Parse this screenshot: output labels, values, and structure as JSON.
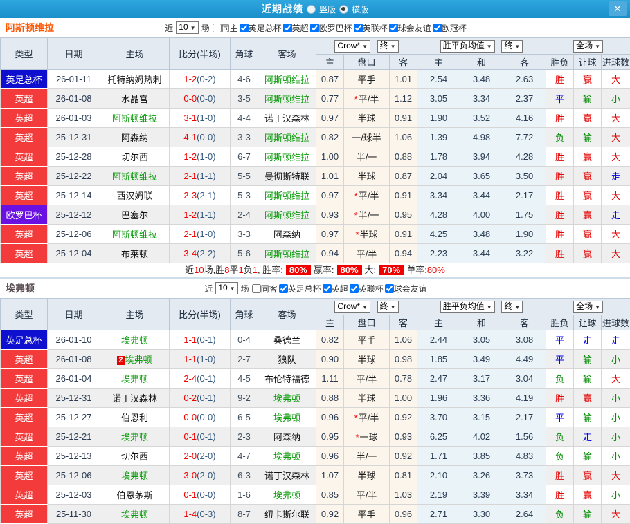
{
  "titlebar": {
    "title": "近期战绩",
    "radio_vertical": "竖版",
    "radio_horizontal": "横版",
    "close": "✕"
  },
  "columns": {
    "type": "类型",
    "date": "日期",
    "home": "主场",
    "score": "比分(半场)",
    "corner": "角球",
    "away": "客场",
    "h": "主",
    "handicap": "盘口",
    "a": "客",
    "avg_h": "主",
    "avg_d": "和",
    "avg_a": "客",
    "outcome": "胜负",
    "let_goal": "让球",
    "goals": "进球数"
  },
  "selects": {
    "bookmaker": "Crow*",
    "final": "终",
    "avg_label": "胜平负均值",
    "final2": "终",
    "scope": "全场",
    "near_count": "10"
  },
  "filter_labels": {
    "near": "近",
    "games": "场"
  },
  "league_colors": {
    "red": "#f43b3b",
    "blue": "#0f10cf",
    "purple": "#6a10e0"
  },
  "result_colors": {
    "r": "#e60000",
    "g": "#008a00",
    "b": "#0000e0"
  },
  "sections": [
    {
      "team": "阿斯顿维拉",
      "team_color": "#ff5500",
      "same_side": "同主",
      "leagues": [
        "英足总杯",
        "英超",
        "欧罗巴杯",
        "英联杯",
        "球会友谊",
        "欧冠杯"
      ],
      "rows": [
        {
          "league": "英足总杯",
          "lc": "blue",
          "date": "26-01-11",
          "home": "托特纳姆热刺",
          "hc": "k",
          "badge": "",
          "score": "1-2",
          "half": "(0-2)",
          "corner": "4-6",
          "away": "阿斯顿维拉",
          "ac": "g",
          "ho": "0.87",
          "star": "",
          "pan": "平手",
          "ao": "1.01",
          "m1": "2.54",
          "m2": "3.48",
          "m3": "2.63",
          "r1": "胜",
          "c1": "r",
          "r2": "赢",
          "c2": "r",
          "r3": "大",
          "c3": "r"
        },
        {
          "league": "英超",
          "lc": "red",
          "date": "26-01-08",
          "home": "水晶宫",
          "hc": "k",
          "badge": "",
          "score": "0-0",
          "half": "(0-0)",
          "corner": "3-5",
          "away": "阿斯顿维拉",
          "ac": "g",
          "ho": "0.77",
          "star": "*",
          "pan": "平/半",
          "ao": "1.12",
          "m1": "3.05",
          "m2": "3.34",
          "m3": "2.37",
          "r1": "平",
          "c1": "b",
          "r2": "输",
          "c2": "g",
          "r3": "小",
          "c3": "g"
        },
        {
          "league": "英超",
          "lc": "red",
          "date": "26-01-03",
          "home": "阿斯顿维拉",
          "hc": "g",
          "badge": "",
          "score": "3-1",
          "half": "(1-0)",
          "corner": "4-4",
          "away": "诺丁汉森林",
          "ac": "k",
          "ho": "0.97",
          "star": "",
          "pan": "半球",
          "ao": "0.91",
          "m1": "1.90",
          "m2": "3.52",
          "m3": "4.16",
          "r1": "胜",
          "c1": "r",
          "r2": "赢",
          "c2": "r",
          "r3": "大",
          "c3": "r"
        },
        {
          "league": "英超",
          "lc": "red",
          "date": "25-12-31",
          "home": "阿森纳",
          "hc": "k",
          "badge": "",
          "score": "4-1",
          "half": "(0-0)",
          "corner": "3-3",
          "away": "阿斯顿维拉",
          "ac": "g",
          "ho": "0.82",
          "star": "",
          "pan": "一/球半",
          "ao": "1.06",
          "m1": "1.39",
          "m2": "4.98",
          "m3": "7.72",
          "r1": "负",
          "c1": "g",
          "r2": "输",
          "c2": "g",
          "r3": "大",
          "c3": "r"
        },
        {
          "league": "英超",
          "lc": "red",
          "date": "25-12-28",
          "home": "切尔西",
          "hc": "k",
          "badge": "",
          "score": "1-2",
          "half": "(1-0)",
          "corner": "6-7",
          "away": "阿斯顿维拉",
          "ac": "g",
          "ho": "1.00",
          "star": "",
          "pan": "半/一",
          "ao": "0.88",
          "m1": "1.78",
          "m2": "3.94",
          "m3": "4.28",
          "r1": "胜",
          "c1": "r",
          "r2": "赢",
          "c2": "r",
          "r3": "大",
          "c3": "r"
        },
        {
          "league": "英超",
          "lc": "red",
          "date": "25-12-22",
          "home": "阿斯顿维拉",
          "hc": "g",
          "badge": "",
          "score": "2-1",
          "half": "(1-1)",
          "corner": "5-5",
          "away": "曼彻斯特联",
          "ac": "k",
          "ho": "1.01",
          "star": "",
          "pan": "半球",
          "ao": "0.87",
          "m1": "2.04",
          "m2": "3.65",
          "m3": "3.50",
          "r1": "胜",
          "c1": "r",
          "r2": "赢",
          "c2": "r",
          "r3": "走",
          "c3": "b"
        },
        {
          "league": "英超",
          "lc": "red",
          "date": "25-12-14",
          "home": "西汉姆联",
          "hc": "k",
          "badge": "",
          "score": "2-3",
          "half": "(2-1)",
          "corner": "5-3",
          "away": "阿斯顿维拉",
          "ac": "g",
          "ho": "0.97",
          "star": "*",
          "pan": "平/半",
          "ao": "0.91",
          "m1": "3.34",
          "m2": "3.44",
          "m3": "2.17",
          "r1": "胜",
          "c1": "r",
          "r2": "赢",
          "c2": "r",
          "r3": "大",
          "c3": "r"
        },
        {
          "league": "欧罗巴杯",
          "lc": "purple",
          "date": "25-12-12",
          "home": "巴塞尔",
          "hc": "k",
          "badge": "",
          "score": "1-2",
          "half": "(1-1)",
          "corner": "2-4",
          "away": "阿斯顿维拉",
          "ac": "g",
          "ho": "0.93",
          "star": "*",
          "pan": "半/一",
          "ao": "0.95",
          "m1": "4.28",
          "m2": "4.00",
          "m3": "1.75",
          "r1": "胜",
          "c1": "r",
          "r2": "赢",
          "c2": "r",
          "r3": "走",
          "c3": "b"
        },
        {
          "league": "英超",
          "lc": "red",
          "date": "25-12-06",
          "home": "阿斯顿维拉",
          "hc": "g",
          "badge": "",
          "score": "2-1",
          "half": "(1-0)",
          "corner": "3-3",
          "away": "阿森纳",
          "ac": "k",
          "ho": "0.97",
          "star": "*",
          "pan": "半球",
          "ao": "0.91",
          "m1": "4.25",
          "m2": "3.48",
          "m3": "1.90",
          "r1": "胜",
          "c1": "r",
          "r2": "赢",
          "c2": "r",
          "r3": "大",
          "c3": "r"
        },
        {
          "league": "英超",
          "lc": "red",
          "date": "25-12-04",
          "home": "布莱顿",
          "hc": "k",
          "badge": "",
          "score": "3-4",
          "half": "(2-2)",
          "corner": "5-6",
          "away": "阿斯顿维拉",
          "ac": "g",
          "ho": "0.94",
          "star": "",
          "pan": "平/半",
          "ao": "0.94",
          "m1": "2.23",
          "m2": "3.44",
          "m3": "3.22",
          "r1": "胜",
          "c1": "r",
          "r2": "赢",
          "c2": "r",
          "r3": "大",
          "c3": "r"
        }
      ],
      "summary": {
        "t1": "近",
        "n": "10",
        "t2": "场,胜",
        "w": "8",
        "t3": "平",
        "d": "1",
        "t4": "负",
        "l": "1",
        "t5": ", 胜率:",
        "b1": "80%",
        "t6": "赢率:",
        "b2": "80%",
        "t7": "大:",
        "b3": "70%",
        "t8": "单率:",
        "v": "80%"
      }
    },
    {
      "team": "埃弗顿",
      "team_color": "#584a4e",
      "same_side": "同客",
      "leagues": [
        "英足总杯",
        "英超",
        "英联杯",
        "球会友谊"
      ],
      "rows": [
        {
          "league": "英足总杯",
          "lc": "blue",
          "date": "26-01-10",
          "home": "埃弗顿",
          "hc": "g",
          "badge": "",
          "score": "1-1",
          "half": "(0-1)",
          "corner": "0-4",
          "away": "桑德兰",
          "ac": "k",
          "ho": "0.82",
          "star": "",
          "pan": "平手",
          "ao": "1.06",
          "m1": "2.44",
          "m2": "3.05",
          "m3": "3.08",
          "r1": "平",
          "c1": "b",
          "r2": "走",
          "c2": "b",
          "r3": "走",
          "c3": "b"
        },
        {
          "league": "英超",
          "lc": "red",
          "date": "26-01-08",
          "home": "埃弗顿",
          "hc": "g",
          "badge": "2",
          "score": "1-1",
          "half": "(1-0)",
          "corner": "2-7",
          "away": "狼队",
          "ac": "k",
          "ho": "0.90",
          "star": "",
          "pan": "半球",
          "ao": "0.98",
          "m1": "1.85",
          "m2": "3.49",
          "m3": "4.49",
          "r1": "平",
          "c1": "b",
          "r2": "输",
          "c2": "g",
          "r3": "小",
          "c3": "g"
        },
        {
          "league": "英超",
          "lc": "red",
          "date": "26-01-04",
          "home": "埃弗顿",
          "hc": "g",
          "badge": "",
          "score": "2-4",
          "half": "(0-1)",
          "corner": "4-5",
          "away": "布伦特福德",
          "ac": "k",
          "ho": "1.11",
          "star": "",
          "pan": "平/半",
          "ao": "0.78",
          "m1": "2.47",
          "m2": "3.17",
          "m3": "3.04",
          "r1": "负",
          "c1": "g",
          "r2": "输",
          "c2": "g",
          "r3": "大",
          "c3": "r"
        },
        {
          "league": "英超",
          "lc": "red",
          "date": "25-12-31",
          "home": "诺丁汉森林",
          "hc": "k",
          "badge": "",
          "score": "0-2",
          "half": "(0-1)",
          "corner": "9-2",
          "away": "埃弗顿",
          "ac": "g",
          "ho": "0.88",
          "star": "",
          "pan": "半球",
          "ao": "1.00",
          "m1": "1.96",
          "m2": "3.36",
          "m3": "4.19",
          "r1": "胜",
          "c1": "r",
          "r2": "赢",
          "c2": "r",
          "r3": "小",
          "c3": "g"
        },
        {
          "league": "英超",
          "lc": "red",
          "date": "25-12-27",
          "home": "伯恩利",
          "hc": "k",
          "badge": "",
          "score": "0-0",
          "half": "(0-0)",
          "corner": "6-5",
          "away": "埃弗顿",
          "ac": "g",
          "ho": "0.96",
          "star": "*",
          "pan": "平/半",
          "ao": "0.92",
          "m1": "3.70",
          "m2": "3.15",
          "m3": "2.17",
          "r1": "平",
          "c1": "b",
          "r2": "输",
          "c2": "g",
          "r3": "小",
          "c3": "g"
        },
        {
          "league": "英超",
          "lc": "red",
          "date": "25-12-21",
          "home": "埃弗顿",
          "hc": "g",
          "badge": "",
          "score": "0-1",
          "half": "(0-1)",
          "corner": "2-3",
          "away": "阿森纳",
          "ac": "k",
          "ho": "0.95",
          "star": "*",
          "pan": "一球",
          "ao": "0.93",
          "m1": "6.25",
          "m2": "4.02",
          "m3": "1.56",
          "r1": "负",
          "c1": "g",
          "r2": "走",
          "c2": "b",
          "r3": "小",
          "c3": "g"
        },
        {
          "league": "英超",
          "lc": "red",
          "date": "25-12-13",
          "home": "切尔西",
          "hc": "k",
          "badge": "",
          "score": "2-0",
          "half": "(2-0)",
          "corner": "4-7",
          "away": "埃弗顿",
          "ac": "g",
          "ho": "0.96",
          "star": "",
          "pan": "半/一",
          "ao": "0.92",
          "m1": "1.71",
          "m2": "3.85",
          "m3": "4.83",
          "r1": "负",
          "c1": "g",
          "r2": "输",
          "c2": "g",
          "r3": "小",
          "c3": "g"
        },
        {
          "league": "英超",
          "lc": "red",
          "date": "25-12-06",
          "home": "埃弗顿",
          "hc": "g",
          "badge": "",
          "score": "3-0",
          "half": "(2-0)",
          "corner": "6-3",
          "away": "诺丁汉森林",
          "ac": "k",
          "ho": "1.07",
          "star": "",
          "pan": "半球",
          "ao": "0.81",
          "m1": "2.10",
          "m2": "3.26",
          "m3": "3.73",
          "r1": "胜",
          "c1": "r",
          "r2": "赢",
          "c2": "r",
          "r3": "大",
          "c3": "r"
        },
        {
          "league": "英超",
          "lc": "red",
          "date": "25-12-03",
          "home": "伯恩茅斯",
          "hc": "k",
          "badge": "",
          "score": "0-1",
          "half": "(0-0)",
          "corner": "1-6",
          "away": "埃弗顿",
          "ac": "g",
          "ho": "0.85",
          "star": "",
          "pan": "平/半",
          "ao": "1.03",
          "m1": "2.19",
          "m2": "3.39",
          "m3": "3.34",
          "r1": "胜",
          "c1": "r",
          "r2": "赢",
          "c2": "r",
          "r3": "小",
          "c3": "g"
        },
        {
          "league": "英超",
          "lc": "red",
          "date": "25-11-30",
          "home": "埃弗顿",
          "hc": "g",
          "badge": "",
          "score": "1-4",
          "half": "(0-3)",
          "corner": "8-7",
          "away": "纽卡斯尔联",
          "ac": "k",
          "ho": "0.92",
          "star": "",
          "pan": "平手",
          "ao": "0.96",
          "m1": "2.71",
          "m2": "3.30",
          "m3": "2.64",
          "r1": "负",
          "c1": "g",
          "r2": "输",
          "c2": "g",
          "r3": "大",
          "c3": "r"
        }
      ]
    }
  ]
}
